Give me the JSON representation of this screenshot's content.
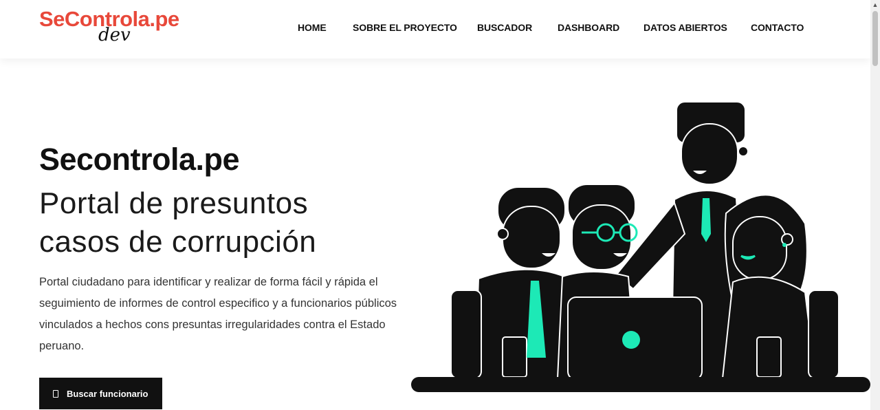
{
  "brand": {
    "name": "SeControla.pe",
    "badge": "dev",
    "accent_color": "#e8483a"
  },
  "nav": {
    "items": [
      {
        "label": "HOME"
      },
      {
        "label": "SOBRE EL PROYECTO"
      },
      {
        "label": "BUSCADOR"
      },
      {
        "label": "DASHBOARD"
      },
      {
        "label": "DATOS ABIERTOS"
      },
      {
        "label": "CONTACTO"
      }
    ]
  },
  "hero": {
    "title": "Secontrola.pe",
    "subtitle_line1": "Portal de presuntos",
    "subtitle_line2": "casos de corrupción",
    "description": "Portal ciudadano para identificar y realizar de forma fácil y rápida el seguimiento de informes de control especifico y a funcionarios públicos vinculados a hechos cons presuntas irregularidades contra el Estado peruano.",
    "cta_label": "Buscar funcionario",
    "cta_icon": "phone-icon"
  },
  "illustration": {
    "name": "team-at-laptop-illustration",
    "accent_color": "#1de9b6",
    "ink_color": "#111111"
  }
}
